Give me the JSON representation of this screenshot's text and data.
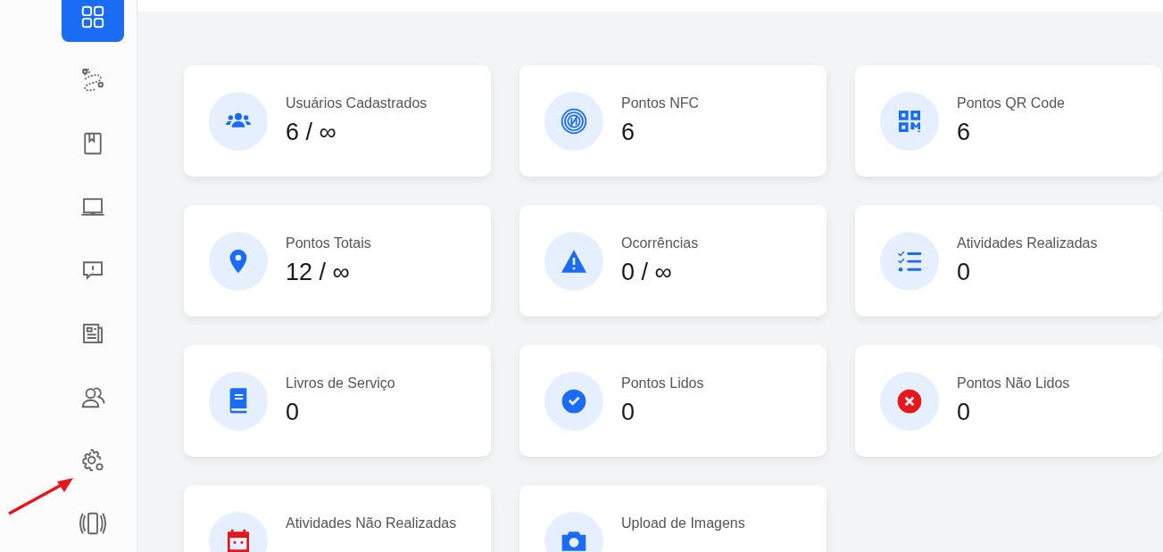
{
  "sidebar": {
    "items": [
      {
        "selected": true
      },
      {
        "selected": false
      },
      {
        "selected": false
      },
      {
        "selected": false
      },
      {
        "selected": false
      },
      {
        "selected": false
      },
      {
        "selected": false
      },
      {
        "selected": false
      },
      {
        "selected": false
      }
    ]
  },
  "cards": [
    {
      "title": "Usuários Cadastrados",
      "value": "6 / ∞",
      "color": "#1a6cf5"
    },
    {
      "title": "Pontos NFC",
      "value": "6",
      "color": "#1a6cf5"
    },
    {
      "title": "Pontos QR Code",
      "value": "6",
      "color": "#1a6cf5"
    },
    {
      "title": "Pontos Totais",
      "value": "12 / ∞",
      "color": "#1a6cf5"
    },
    {
      "title": "Ocorrências",
      "value": "0 / ∞",
      "color": "#1a6cf5"
    },
    {
      "title": "Atividades Realizadas",
      "value": "0",
      "color": "#1a6cf5"
    },
    {
      "title": "Livros de Serviço",
      "value": "0",
      "color": "#1a6cf5"
    },
    {
      "title": "Pontos Lidos",
      "value": "0",
      "color": "#1a6cf5"
    },
    {
      "title": "Pontos Não Lidos",
      "value": "0",
      "color": "#e5161c"
    },
    {
      "title": "Atividades Não Realizadas",
      "color": "#e5161c"
    },
    {
      "title": "Upload de Imagens",
      "color": "#1a6cf5"
    }
  ]
}
